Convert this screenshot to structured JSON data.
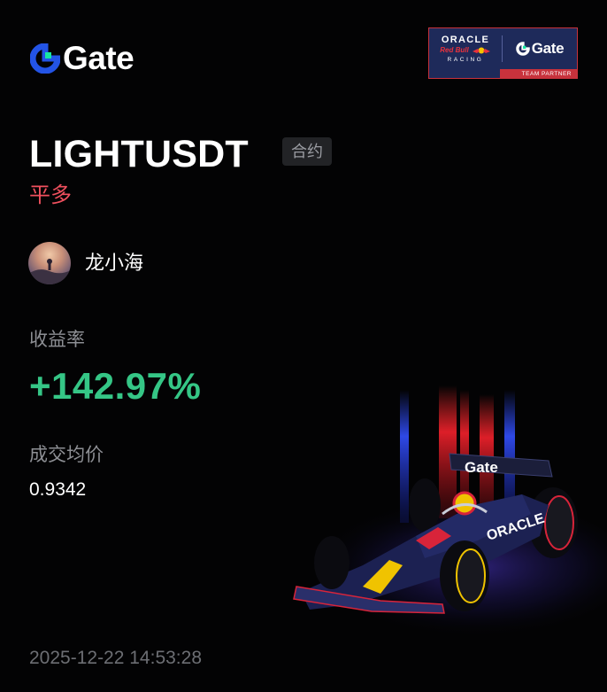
{
  "brand": {
    "logo_text": "Gate"
  },
  "partner_badge": {
    "oracle": "ORACLE",
    "redbull": "Red Bull",
    "racing": "RACING",
    "gate": "Gate",
    "footer": "TEAM PARTNER"
  },
  "trade": {
    "symbol": "LIGHTUSDT",
    "tag": "合约",
    "direction": "平多"
  },
  "user": {
    "name": "龙小海"
  },
  "metrics": {
    "roi_label": "收益率",
    "roi_value": "+142.97%",
    "avg_price_label": "成交均价",
    "avg_price_value": "0.9342"
  },
  "timestamp": "2025-12-22 14:53:28",
  "car_wing_text": "Gate",
  "car_sidepod_text": "ORACLE",
  "colors": {
    "background": "#030304",
    "profit_green": "#35c686",
    "direction_red": "#f0505e",
    "gate_blue": "#2354e6",
    "gate_green": "#17e6a1"
  }
}
